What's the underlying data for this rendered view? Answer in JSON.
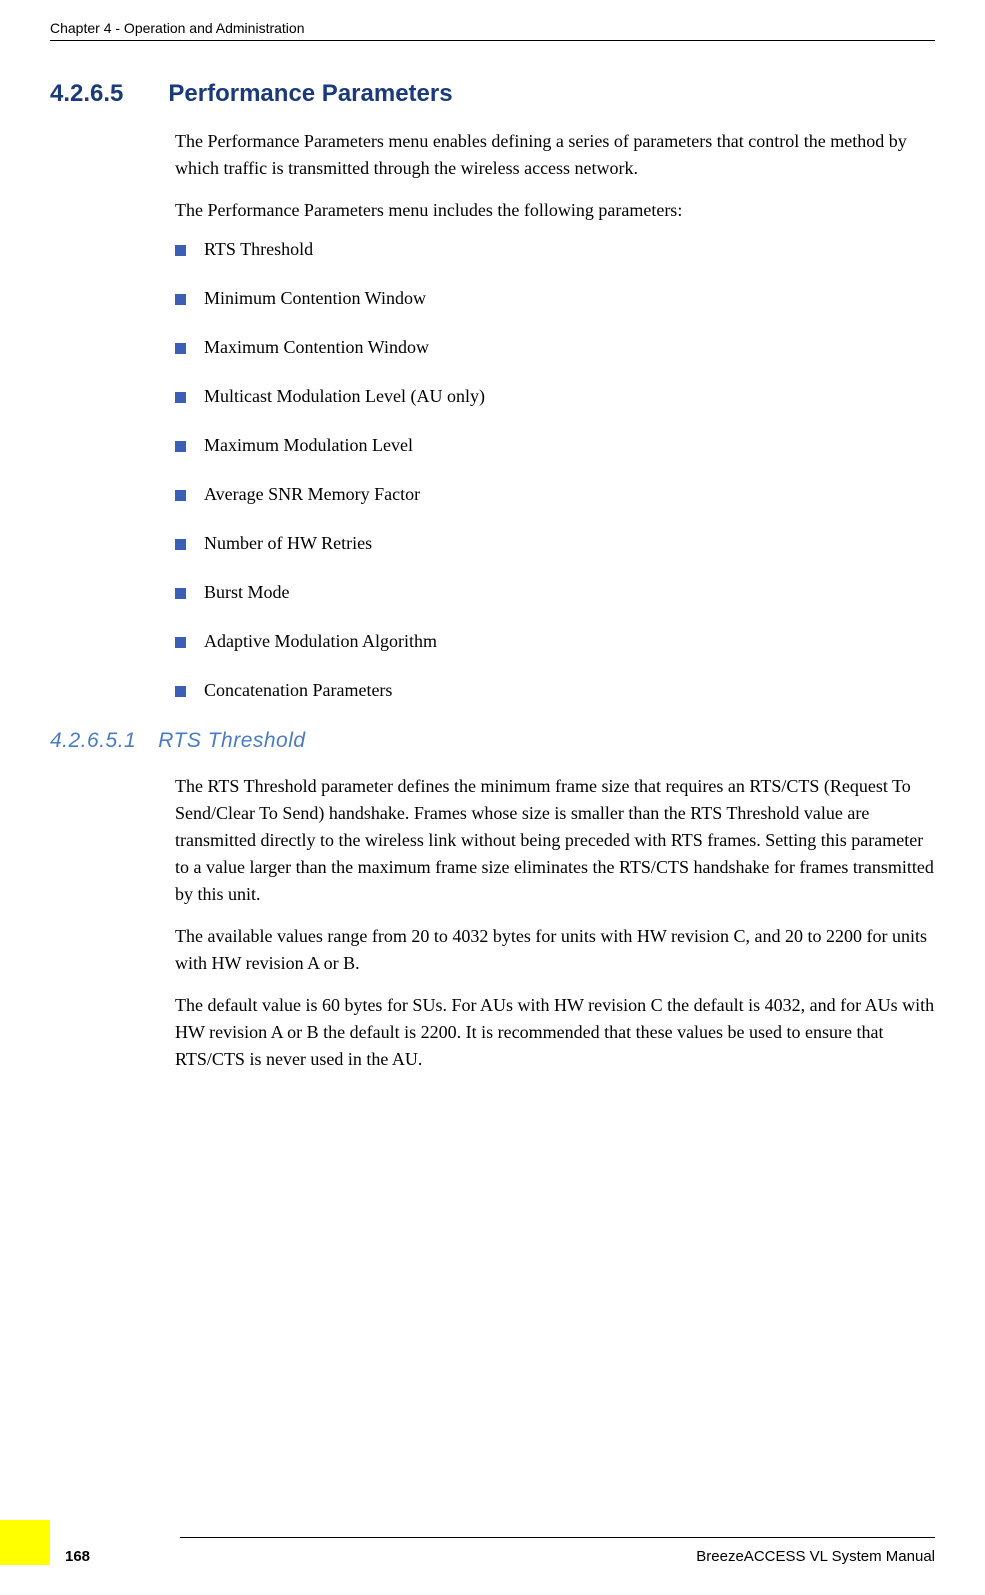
{
  "header": {
    "chapter": "Chapter 4 - Operation and Administration"
  },
  "section1": {
    "number": "4.2.6.5",
    "title": "Performance Parameters",
    "para1": "The Performance Parameters menu enables defining a series of parameters that control the method by which traffic is transmitted through the wireless access network.",
    "para2": "The Performance Parameters menu includes the following parameters:",
    "bullets": [
      "RTS Threshold",
      "Minimum Contention Window",
      "Maximum Contention Window",
      "Multicast Modulation Level (AU only)",
      "Maximum Modulation Level",
      "Average SNR Memory Factor",
      "Number of HW Retries",
      "Burst Mode",
      "Adaptive Modulation Algorithm",
      "Concatenation Parameters"
    ]
  },
  "section2": {
    "number": "4.2.6.5.1",
    "title": "RTS Threshold",
    "para1": "The RTS Threshold parameter defines the minimum frame size that requires an RTS/CTS (Request To Send/Clear To Send) handshake. Frames whose size is smaller than the RTS Threshold value are transmitted directly to the wireless link without being preceded with RTS frames. Setting this parameter to a value larger than the maximum frame size eliminates the RTS/CTS handshake for frames transmitted by this unit.",
    "para2": "The available values range from 20 to 4032 bytes for units with HW revision C, and 20 to 2200 for units with HW revision A or B.",
    "para3": "The default value is 60 bytes for SUs. For AUs with HW revision C the default is 4032, and for AUs with HW revision A or B the default is 2200. It is recommended that these values be used to ensure that RTS/CTS is never used in the AU."
  },
  "footer": {
    "manual": "BreezeACCESS VL System Manual",
    "page": "168"
  }
}
